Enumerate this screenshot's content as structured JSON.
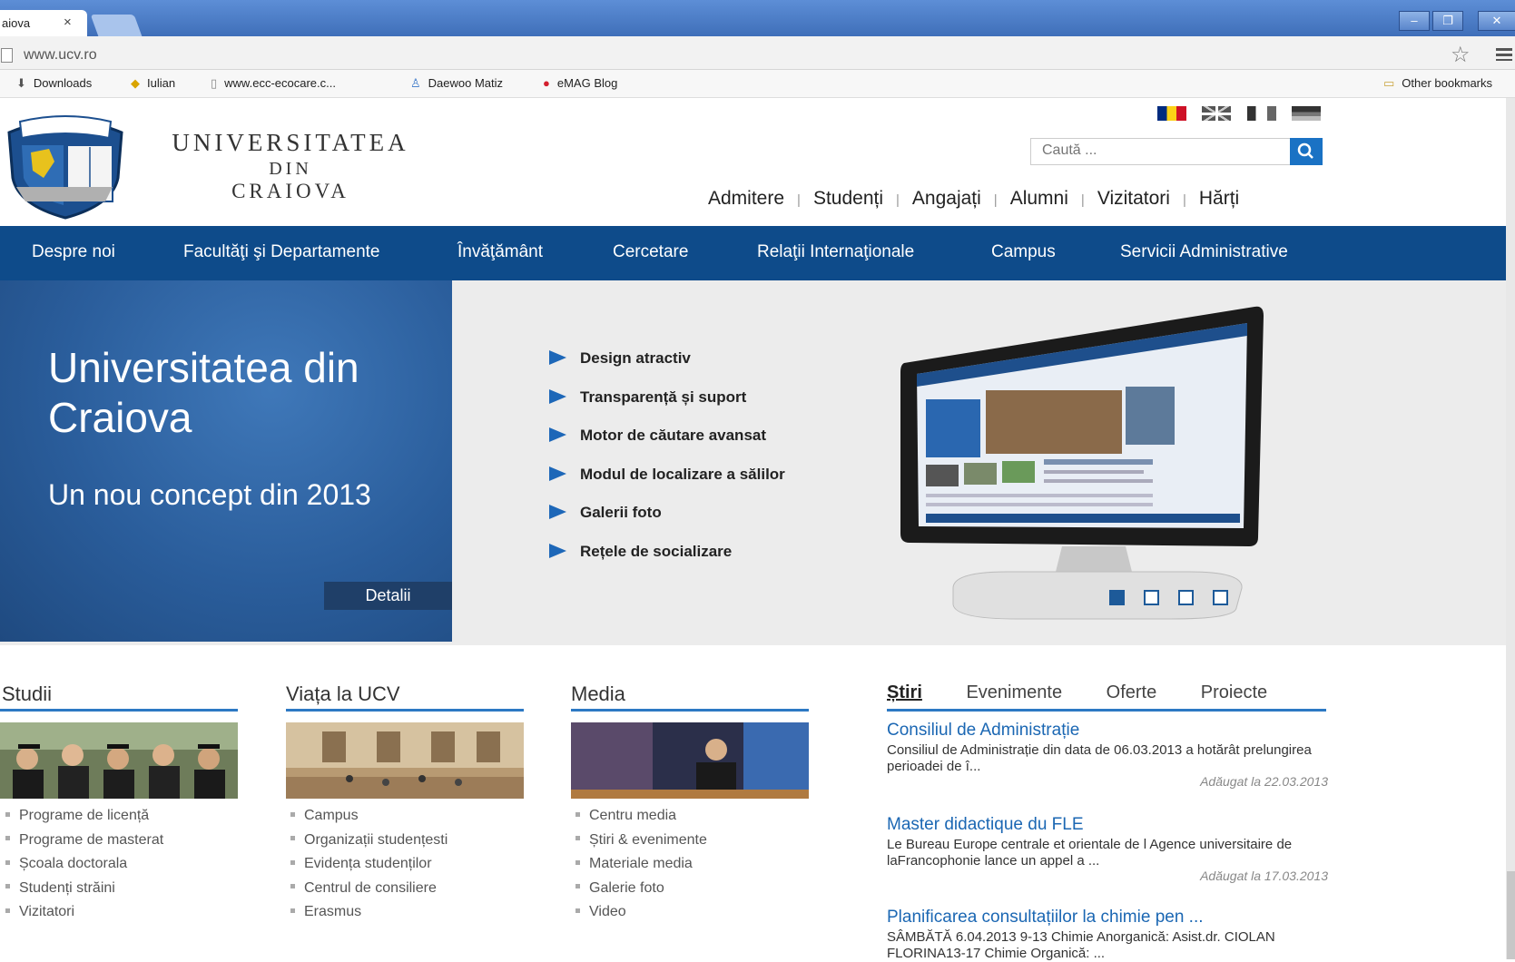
{
  "browser": {
    "tab_title": "aiova",
    "tab_close": "×",
    "url": "www.ucv.ro",
    "window_controls": [
      "–",
      "❐",
      "✕"
    ],
    "bookmarks": [
      "Downloads",
      "Iulian",
      "www.ecc-ecocare.c...",
      "Daewoo Matiz",
      "eMAG Blog"
    ],
    "other_bookmarks": "Other bookmarks"
  },
  "header": {
    "name_line1": "UNIVERSITATEA",
    "name_line2": "DIN",
    "name_line3": "CRAIOVA",
    "search_placeholder": "Caută ...",
    "top_nav": [
      "Admitere",
      "Studenți",
      "Angajați",
      "Alumni",
      "Vizitatori",
      "Hărți"
    ],
    "flags": [
      "ro-flag",
      "uk-flag",
      "fr-flag",
      "de-flag"
    ]
  },
  "main_nav": [
    "Despre noi",
    "Facultăţi şi Departamente",
    "Învăţământ",
    "Cercetare",
    "Relaţii Internaţionale",
    "Campus",
    "Servicii Administrative"
  ],
  "hero": {
    "title": "Universitatea din Craiova",
    "subtitle": "Un nou concept din 2013",
    "button": "Detalii",
    "features": [
      "Design atractiv",
      "Transparență și suport",
      "Motor de căutare avansat",
      "Modul de localizare a sălilor",
      "Galerii foto",
      "Rețele de socializare"
    ],
    "slide_count": 4,
    "active_slide": 1
  },
  "sections": [
    {
      "title": "Studii",
      "items": [
        "Programe de licență",
        "Programe de masterat",
        "Școala doctorala",
        "Studenți străini",
        "Vizitatori"
      ]
    },
    {
      "title": "Viața la UCV",
      "items": [
        "Campus",
        "Organizații studențesti",
        "Evidența studenților",
        "Centrul de consiliere",
        "Erasmus"
      ]
    },
    {
      "title": "Media",
      "items": [
        "Centru media",
        "Știri & evenimente",
        "Materiale media",
        "Galerie foto",
        "Video"
      ]
    }
  ],
  "news": {
    "tabs": [
      "Știri",
      "Evenimente",
      "Oferte",
      "Proiecte"
    ],
    "active_tab": "Știri",
    "items": [
      {
        "title": "Consiliul de Administrație",
        "text": "Consiliul de Administrație din data de 06.03.2013 a hotărât prelungirea perioadei de î...",
        "date": "Adăugat la 22.03.2013"
      },
      {
        "title": "Master didactique du FLE",
        "text": "Le Bureau Europe centrale et orientale de l Agence universitaire de laFrancophonie lance un appel a ...",
        "date": "Adăugat la 17.03.2013"
      },
      {
        "title": "Planificarea consultațiilor la chimie pen ...",
        "text": "SÂMBĂTĂ 6.04.2013 9-13 Chimie Anorganică: Asist.dr. CIOLAN FLORINA13-17 Chimie Organică: ...",
        "date": ""
      }
    ]
  },
  "colors": {
    "nav_blue": "#0e4b8a",
    "accent_blue": "#2d79c4",
    "link_blue": "#1b67b3"
  }
}
